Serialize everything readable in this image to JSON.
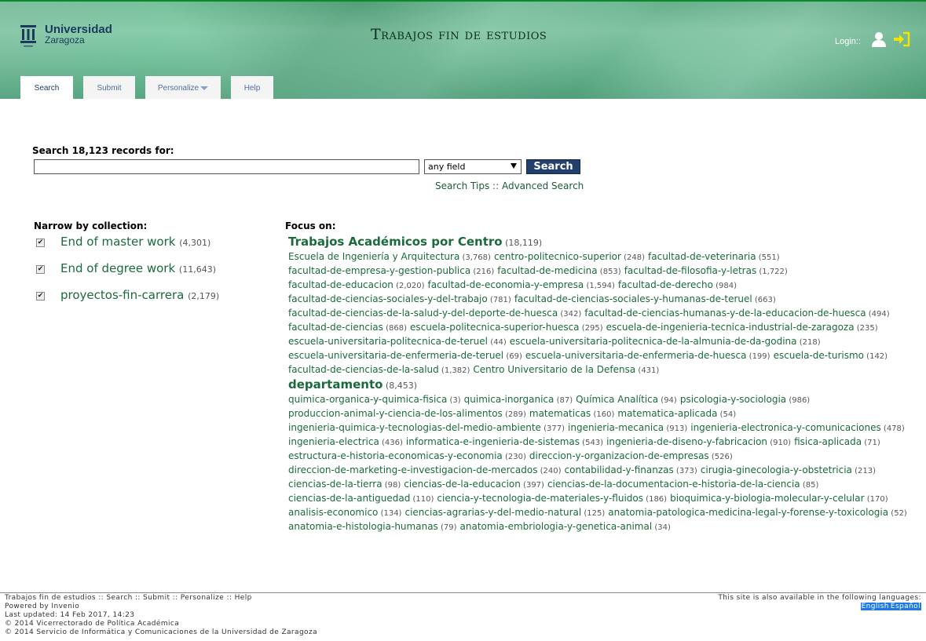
{
  "header": {
    "logo_line1": "Universidad",
    "logo_line2": "Zaragoza",
    "site_title": "Trabajos fin de estudios",
    "login_label": "Login::",
    "colors": {
      "band_top": "#0a8a2a",
      "band": "#68bd94",
      "signin": "#f2e600"
    }
  },
  "tabs": [
    {
      "label": "Search",
      "active": true
    },
    {
      "label": "Submit",
      "active": false
    },
    {
      "label": "Personalize",
      "active": false
    },
    {
      "label": "Help",
      "active": false
    }
  ],
  "search": {
    "label": "Search 18,123 records for:",
    "value": "",
    "field_selected": "any field",
    "button_label": "Search",
    "tips_label": "Search Tips",
    "separator": "::",
    "advanced_label": "Advanced Search"
  },
  "narrow": {
    "title": "Narrow by collection:",
    "items": [
      {
        "label": "End of master work",
        "count": "(4,301)",
        "checked": true
      },
      {
        "label": "End of degree work",
        "count": "(11,643)",
        "checked": true
      },
      {
        "label": "proyectos-fin-carrera",
        "count": "(2,179)",
        "checked": true
      }
    ]
  },
  "focus": {
    "title": "Focus on:",
    "groups": [
      {
        "label": "Trabajos Académicos por Centro",
        "count": "(18,119)",
        "lines": [
          [
            [
              "Escuela de Ingeniería y Arquitectura",
              "(3,768)"
            ],
            [
              "centro-politecnico-superior",
              "(248)"
            ],
            [
              "facultad-de-veterinaria",
              "(551)"
            ]
          ],
          [
            [
              "facultad-de-empresa-y-gestion-publica",
              "(216)"
            ],
            [
              "facultad-de-medicina",
              "(853)"
            ],
            [
              "facultad-de-filosofia-y-letras",
              "(1,722)"
            ]
          ],
          [
            [
              "facultad-de-educacion",
              "(2,020)"
            ],
            [
              "facultad-de-economia-y-empresa",
              "(1,594)"
            ],
            [
              "facultad-de-derecho",
              "(984)"
            ]
          ],
          [
            [
              "facultad-de-ciencias-sociales-y-del-trabajo",
              "(781)"
            ],
            [
              "facultad-de-ciencias-sociales-y-humanas-de-teruel",
              "(663)"
            ]
          ],
          [
            [
              "facultad-de-ciencias-de-la-salud-y-del-deporte-de-huesca",
              "(342)"
            ],
            [
              "facultad-de-ciencias-humanas-y-de-la-educacion-de-huesca",
              "(494)"
            ]
          ],
          [
            [
              "facultad-de-ciencias",
              "(868)"
            ],
            [
              "escuela-politecnica-superior-huesca",
              "(295)"
            ],
            [
              "escuela-de-ingenieria-tecnica-industrial-de-zaragoza",
              "(235)"
            ]
          ],
          [
            [
              "escuela-universitaria-politecnica-de-teruel",
              "(44)"
            ],
            [
              "escuela-universitaria-politecnica-de-la-almunia-de-da-godina",
              "(218)"
            ]
          ],
          [
            [
              "escuela-universitaria-de-enfermeria-de-teruel",
              "(69)"
            ],
            [
              "escuela-universitaria-de-enfermeria-de-huesca",
              "(199)"
            ],
            [
              "escuela-de-turismo",
              "(142)"
            ]
          ],
          [
            [
              "facultad-de-ciencias-de-la-salud",
              "(1,382)"
            ],
            [
              "Centro Universitario de la Defensa",
              "(431)"
            ]
          ]
        ]
      },
      {
        "label": "departamento",
        "count": "(8,453)",
        "lines": [
          [
            [
              "quimica-organica-y-quimica-fisica",
              "(3)"
            ],
            [
              "quimica-inorganica",
              "(87)"
            ],
            [
              "Química Analítica",
              "(94)"
            ],
            [
              "psicologia-y-sociologia",
              "(986)"
            ]
          ],
          [
            [
              "produccion-animal-y-ciencia-de-los-alimentos",
              "(289)"
            ],
            [
              "matematicas",
              "(160)"
            ],
            [
              "matematica-aplicada",
              "(54)"
            ]
          ],
          [
            [
              "ingenieria-quimica-y-tecnologias-del-medio-ambiente",
              "(377)"
            ],
            [
              "ingenieria-mecanica",
              "(913)"
            ],
            [
              "ingenieria-electronica-y-comunicaciones",
              "(478)"
            ]
          ],
          [
            [
              "ingenieria-electrica",
              "(436)"
            ],
            [
              "informatica-e-ingenieria-de-sistemas",
              "(543)"
            ],
            [
              "ingenieria-de-diseno-y-fabricacion",
              "(910)"
            ],
            [
              "fisica-aplicada",
              "(71)"
            ]
          ],
          [
            [
              "estructura-e-historia-economicas-y-economia",
              "(230)"
            ],
            [
              "direccion-y-organizacion-de-empresas",
              "(526)"
            ]
          ],
          [
            [
              "direccion-de-marketing-e-investigacion-de-mercados",
              "(240)"
            ],
            [
              "contabilidad-y-finanzas",
              "(373)"
            ],
            [
              "cirugia-ginecologia-y-obstetricia",
              "(213)"
            ]
          ],
          [
            [
              "ciencias-de-la-tierra",
              "(98)"
            ],
            [
              "ciencias-de-la-educacion",
              "(397)"
            ],
            [
              "ciencias-de-la-documentacion-e-historia-de-la-ciencia",
              "(85)"
            ]
          ],
          [
            [
              "ciencias-de-la-antiguedad",
              "(110)"
            ],
            [
              "ciencia-y-tecnologia-de-materiales-y-fluidos",
              "(186)"
            ],
            [
              "bioquimica-y-biologia-molecular-y-celular",
              "(170)"
            ]
          ],
          [
            [
              "analisis-economico",
              "(134)"
            ],
            [
              "ciencias-agrarias-y-del-medio-natural",
              "(125)"
            ],
            [
              "anatomia-patologica-medicina-legal-y-forense-y-toxicologia",
              "(52)"
            ]
          ],
          [
            [
              "anatomia-e-histologia-humanas",
              "(79)"
            ],
            [
              "anatomia-embriologia-y-genetica-animal",
              "(34)"
            ]
          ]
        ]
      }
    ]
  },
  "footer": {
    "nav": "Trabajos fin de estudios :: Search :: Submit :: Personalize :: Help",
    "powered": "Powered by Invenio",
    "updated": "Last updated: 14 Feb 2017, 14:23",
    "copy1": "© 2014 Vicerrectorado de Política Académica",
    "copy2": "© 2014 Servicio de Informática y Comunicaciones de la Universidad de Zaragoza",
    "lang_note": "This site is also available in the following languages:",
    "lang_en": "English",
    "lang_es": "Español"
  }
}
